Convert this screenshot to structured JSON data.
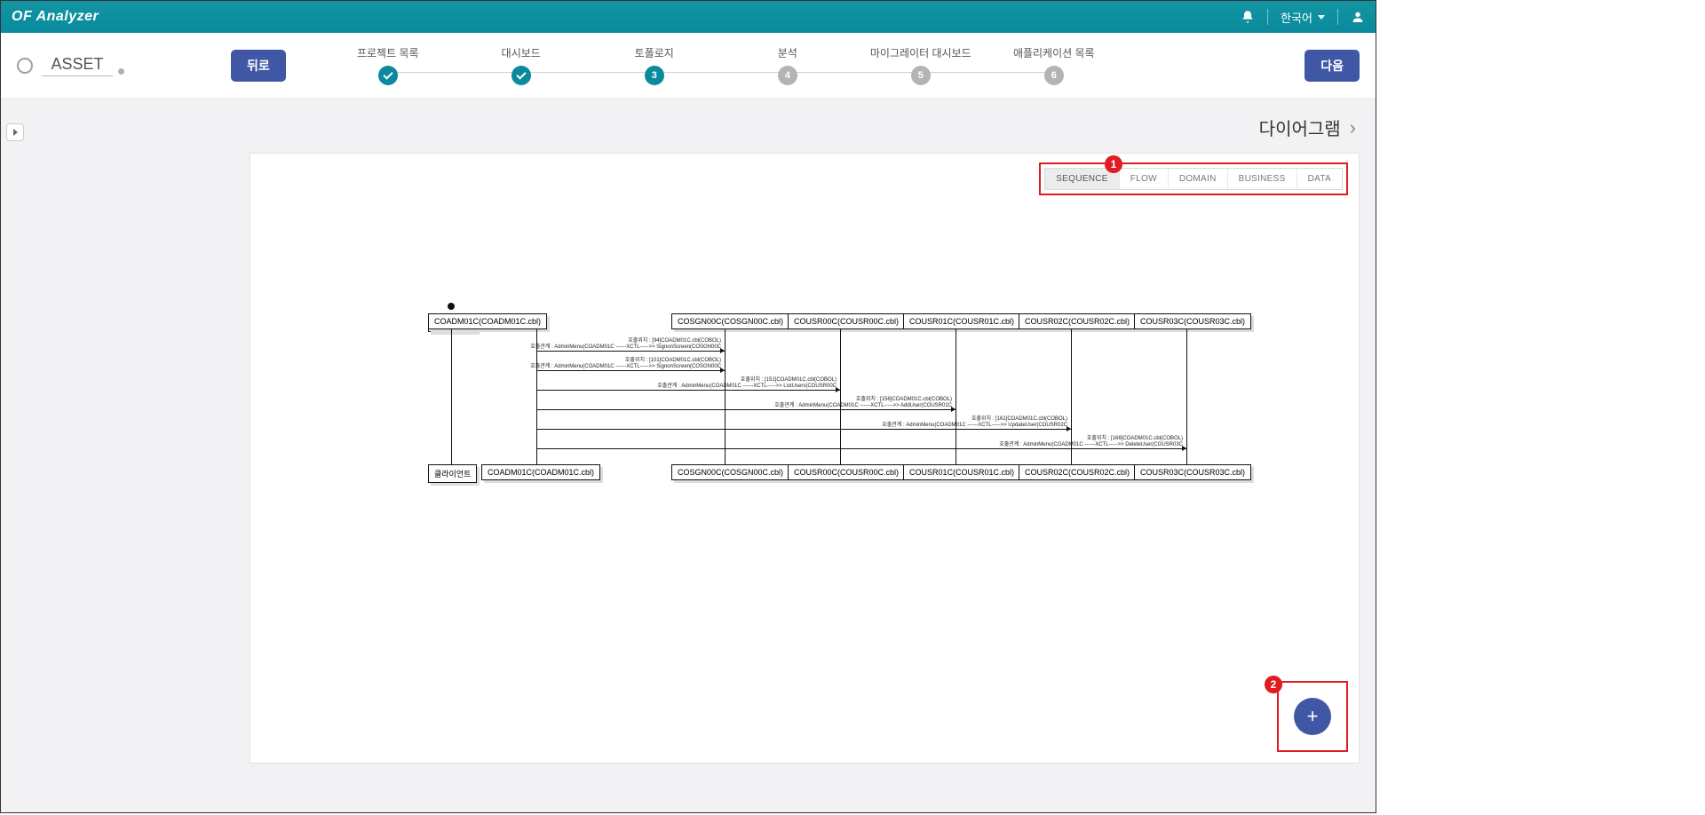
{
  "app_title": "OF Analyzer",
  "language_label": "한국어",
  "asset_label": "ASSET",
  "back_btn": "뒤로",
  "next_btn": "다음",
  "steps": [
    {
      "label": "프로젝트 목록",
      "state": "done"
    },
    {
      "label": "대시보드",
      "state": "done"
    },
    {
      "label": "토폴로지",
      "state": "cur",
      "num": "3"
    },
    {
      "label": "분석",
      "state": "todo",
      "num": "4"
    },
    {
      "label": "마이그레이터 대시보드",
      "state": "todo",
      "num": "5"
    },
    {
      "label": "애플리케이션 목록",
      "state": "todo",
      "num": "6"
    }
  ],
  "crumb_title": "다이어그램",
  "diagram_tabs": [
    "SEQUENCE",
    "FLOW",
    "DOMAIN",
    "BUSINESS",
    "DATA"
  ],
  "callouts": {
    "tabs": "1",
    "fab": "2"
  },
  "sequence": {
    "client_label": "클라이언트",
    "participants": [
      "COADM01C(COADM01C.cbl)",
      "COSGN00C(COSGN00C.cbl)",
      "COUSR00C(COUSR00C.cbl)",
      "COUSR01C(COUSR01C.cbl)",
      "COUSR02C(COUSR02C.cbl)",
      "COUSR03C(COUSR03C.cbl)"
    ],
    "messages": [
      {
        "line1": "호출위치 : [94]COADM01C.cbl(COBOL)",
        "line2": "호출관계 : AdminMenu(COADM01C ------XCTL----->> SignonScreen(COSGN00C"
      },
      {
        "line1": "호출위치 : [101]COADM01C.cbl(COBOL)",
        "line2": "호출관계 : AdminMenu(COADM01C ------XCTL----->> SignonScreen(COSGN00C"
      },
      {
        "line1": "호출위치 : [151]COADM01C.cbl(COBOL)",
        "line2": "호출관계 : AdminMenu(COADM01C ------XCTL----->> ListUsers(COUSR00C"
      },
      {
        "line1": "호출위치 : [156]COADM01C.cbl(COBOL)",
        "line2": "호출관계 : AdminMenu(COADM01C ------XCTL----->> AddUser(COUSR01C"
      },
      {
        "line1": "호출위치 : [161]COADM01C.cbl(COBOL)",
        "line2": "호출관계 : AdminMenu(COADM01C ------XCTL----->> UpdateUser(COUSR02C"
      },
      {
        "line1": "호출위치 : [166]COADM01C.cbl(COBOL)",
        "line2": "호출관계 : AdminMenu(COADM01C ------XCTL----->> DeleteUser(COUSR03C"
      }
    ]
  }
}
